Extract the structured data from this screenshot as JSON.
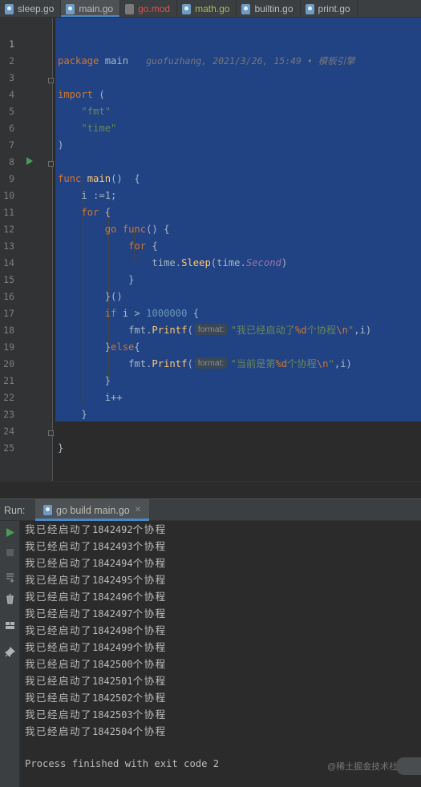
{
  "tabs": [
    {
      "label": "sleep.go",
      "icon": "go-file-icon",
      "state": "normal"
    },
    {
      "label": "main.go",
      "icon": "go-file-icon",
      "state": "active"
    },
    {
      "label": "go.mod",
      "icon": "go-mod-icon",
      "state": "modified"
    },
    {
      "label": "math.go",
      "icon": "go-file-icon",
      "state": "changed"
    },
    {
      "label": "builtin.go",
      "icon": "go-file-icon",
      "state": "normal"
    },
    {
      "label": "print.go",
      "icon": "go-file-icon",
      "state": "normal"
    }
  ],
  "editor": {
    "line_numbers": [
      "1",
      "2",
      "3",
      "4",
      "5",
      "6",
      "7",
      "8",
      "9",
      "10",
      "11",
      "12",
      "13",
      "14",
      "15",
      "16",
      "17",
      "18",
      "19",
      "20",
      "21",
      "22",
      "23",
      "24",
      "25"
    ],
    "line1": {
      "kw": "package",
      "name": "main",
      "blame": "guofuzhang, 2021/3/26, 15:49 • 模板引擎"
    },
    "line3": {
      "kw": "import",
      "paren": "("
    },
    "line4": "\"fmt\"",
    "line5": "\"time\"",
    "line6": ")",
    "line8": {
      "kw": "func",
      "name": "main",
      "rest": "()  {"
    },
    "line9": "i :=1;",
    "line10": {
      "kw": "for",
      "rest": " {"
    },
    "line11": {
      "kw1": "go",
      "kw2": "func",
      "rest": "() {"
    },
    "line12": {
      "kw": "for",
      "rest": " {"
    },
    "line13": {
      "pkg": "time",
      "dot1": ".",
      "fn": "Sleep",
      "open": "(",
      "pkg2": "time",
      "dot2": ".",
      "const": "Second",
      "close": ")"
    },
    "line14": "}",
    "line15": "}()",
    "line16": {
      "kw": "if",
      "rest": " i > ",
      "num": "1000000",
      "tail": " {"
    },
    "line17": {
      "call": "fmt.",
      "fn": "Printf",
      "open": "(",
      "hint": "format:",
      "str1": "\"我已经启动了",
      "fmt": "%d",
      "str2": "个协程",
      "esc": "\\n",
      "str3": "\"",
      "tail": ",i)"
    },
    "line18": {
      "brace": "}",
      "kw": "else",
      "tail": "{"
    },
    "line19": {
      "call": "fmt.",
      "fn": "Printf",
      "open": "(",
      "hint": "format:",
      "str1": "\"当前是第",
      "fmt": "%d",
      "str2": "个协程",
      "esc": "\\n",
      "str3": "\"",
      "tail": ",i)"
    },
    "line20": "}",
    "line21": "i++",
    "line22": "}",
    "line24": "}"
  },
  "run": {
    "label": "Run:",
    "tab_label": "go build main.go",
    "output_prefix": "我已经启动了",
    "output_suffix": "个协程",
    "output_numbers": [
      "1842492",
      "1842493",
      "1842494",
      "1842495",
      "1842496",
      "1842497",
      "1842498",
      "1842499",
      "1842500",
      "1842501",
      "1842502",
      "1842503",
      "1842504"
    ],
    "process_line": "Process finished with exit code 2",
    "watermark": "@稀土掘金技术社区"
  },
  "colors": {
    "selection": "#214283",
    "keyword": "#cc7832",
    "string": "#6a8759",
    "number": "#6897bb",
    "function": "#ffc66d",
    "run_green": "#499c54"
  }
}
